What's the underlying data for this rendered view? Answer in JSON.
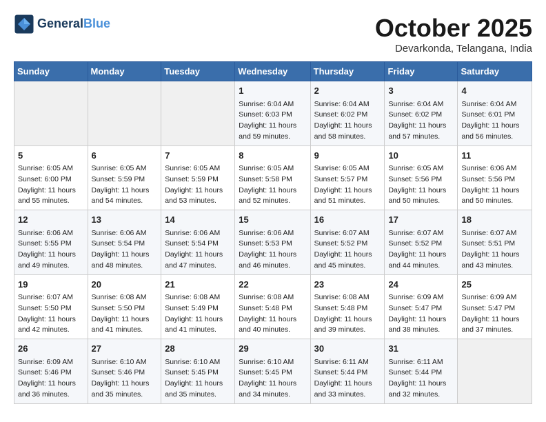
{
  "header": {
    "logo_line1": "General",
    "logo_line2": "Blue",
    "month": "October 2025",
    "location": "Devarkonda, Telangana, India"
  },
  "weekdays": [
    "Sunday",
    "Monday",
    "Tuesday",
    "Wednesday",
    "Thursday",
    "Friday",
    "Saturday"
  ],
  "weeks": [
    [
      {
        "day": "",
        "sunrise": "",
        "sunset": "",
        "daylight": ""
      },
      {
        "day": "",
        "sunrise": "",
        "sunset": "",
        "daylight": ""
      },
      {
        "day": "",
        "sunrise": "",
        "sunset": "",
        "daylight": ""
      },
      {
        "day": "1",
        "sunrise": "Sunrise: 6:04 AM",
        "sunset": "Sunset: 6:03 PM",
        "daylight": "Daylight: 11 hours and 59 minutes."
      },
      {
        "day": "2",
        "sunrise": "Sunrise: 6:04 AM",
        "sunset": "Sunset: 6:02 PM",
        "daylight": "Daylight: 11 hours and 58 minutes."
      },
      {
        "day": "3",
        "sunrise": "Sunrise: 6:04 AM",
        "sunset": "Sunset: 6:02 PM",
        "daylight": "Daylight: 11 hours and 57 minutes."
      },
      {
        "day": "4",
        "sunrise": "Sunrise: 6:04 AM",
        "sunset": "Sunset: 6:01 PM",
        "daylight": "Daylight: 11 hours and 56 minutes."
      }
    ],
    [
      {
        "day": "5",
        "sunrise": "Sunrise: 6:05 AM",
        "sunset": "Sunset: 6:00 PM",
        "daylight": "Daylight: 11 hours and 55 minutes."
      },
      {
        "day": "6",
        "sunrise": "Sunrise: 6:05 AM",
        "sunset": "Sunset: 5:59 PM",
        "daylight": "Daylight: 11 hours and 54 minutes."
      },
      {
        "day": "7",
        "sunrise": "Sunrise: 6:05 AM",
        "sunset": "Sunset: 5:59 PM",
        "daylight": "Daylight: 11 hours and 53 minutes."
      },
      {
        "day": "8",
        "sunrise": "Sunrise: 6:05 AM",
        "sunset": "Sunset: 5:58 PM",
        "daylight": "Daylight: 11 hours and 52 minutes."
      },
      {
        "day": "9",
        "sunrise": "Sunrise: 6:05 AM",
        "sunset": "Sunset: 5:57 PM",
        "daylight": "Daylight: 11 hours and 51 minutes."
      },
      {
        "day": "10",
        "sunrise": "Sunrise: 6:05 AM",
        "sunset": "Sunset: 5:56 PM",
        "daylight": "Daylight: 11 hours and 50 minutes."
      },
      {
        "day": "11",
        "sunrise": "Sunrise: 6:06 AM",
        "sunset": "Sunset: 5:56 PM",
        "daylight": "Daylight: 11 hours and 50 minutes."
      }
    ],
    [
      {
        "day": "12",
        "sunrise": "Sunrise: 6:06 AM",
        "sunset": "Sunset: 5:55 PM",
        "daylight": "Daylight: 11 hours and 49 minutes."
      },
      {
        "day": "13",
        "sunrise": "Sunrise: 6:06 AM",
        "sunset": "Sunset: 5:54 PM",
        "daylight": "Daylight: 11 hours and 48 minutes."
      },
      {
        "day": "14",
        "sunrise": "Sunrise: 6:06 AM",
        "sunset": "Sunset: 5:54 PM",
        "daylight": "Daylight: 11 hours and 47 minutes."
      },
      {
        "day": "15",
        "sunrise": "Sunrise: 6:06 AM",
        "sunset": "Sunset: 5:53 PM",
        "daylight": "Daylight: 11 hours and 46 minutes."
      },
      {
        "day": "16",
        "sunrise": "Sunrise: 6:07 AM",
        "sunset": "Sunset: 5:52 PM",
        "daylight": "Daylight: 11 hours and 45 minutes."
      },
      {
        "day": "17",
        "sunrise": "Sunrise: 6:07 AM",
        "sunset": "Sunset: 5:52 PM",
        "daylight": "Daylight: 11 hours and 44 minutes."
      },
      {
        "day": "18",
        "sunrise": "Sunrise: 6:07 AM",
        "sunset": "Sunset: 5:51 PM",
        "daylight": "Daylight: 11 hours and 43 minutes."
      }
    ],
    [
      {
        "day": "19",
        "sunrise": "Sunrise: 6:07 AM",
        "sunset": "Sunset: 5:50 PM",
        "daylight": "Daylight: 11 hours and 42 minutes."
      },
      {
        "day": "20",
        "sunrise": "Sunrise: 6:08 AM",
        "sunset": "Sunset: 5:50 PM",
        "daylight": "Daylight: 11 hours and 41 minutes."
      },
      {
        "day": "21",
        "sunrise": "Sunrise: 6:08 AM",
        "sunset": "Sunset: 5:49 PM",
        "daylight": "Daylight: 11 hours and 41 minutes."
      },
      {
        "day": "22",
        "sunrise": "Sunrise: 6:08 AM",
        "sunset": "Sunset: 5:48 PM",
        "daylight": "Daylight: 11 hours and 40 minutes."
      },
      {
        "day": "23",
        "sunrise": "Sunrise: 6:08 AM",
        "sunset": "Sunset: 5:48 PM",
        "daylight": "Daylight: 11 hours and 39 minutes."
      },
      {
        "day": "24",
        "sunrise": "Sunrise: 6:09 AM",
        "sunset": "Sunset: 5:47 PM",
        "daylight": "Daylight: 11 hours and 38 minutes."
      },
      {
        "day": "25",
        "sunrise": "Sunrise: 6:09 AM",
        "sunset": "Sunset: 5:47 PM",
        "daylight": "Daylight: 11 hours and 37 minutes."
      }
    ],
    [
      {
        "day": "26",
        "sunrise": "Sunrise: 6:09 AM",
        "sunset": "Sunset: 5:46 PM",
        "daylight": "Daylight: 11 hours and 36 minutes."
      },
      {
        "day": "27",
        "sunrise": "Sunrise: 6:10 AM",
        "sunset": "Sunset: 5:46 PM",
        "daylight": "Daylight: 11 hours and 35 minutes."
      },
      {
        "day": "28",
        "sunrise": "Sunrise: 6:10 AM",
        "sunset": "Sunset: 5:45 PM",
        "daylight": "Daylight: 11 hours and 35 minutes."
      },
      {
        "day": "29",
        "sunrise": "Sunrise: 6:10 AM",
        "sunset": "Sunset: 5:45 PM",
        "daylight": "Daylight: 11 hours and 34 minutes."
      },
      {
        "day": "30",
        "sunrise": "Sunrise: 6:11 AM",
        "sunset": "Sunset: 5:44 PM",
        "daylight": "Daylight: 11 hours and 33 minutes."
      },
      {
        "day": "31",
        "sunrise": "Sunrise: 6:11 AM",
        "sunset": "Sunset: 5:44 PM",
        "daylight": "Daylight: 11 hours and 32 minutes."
      },
      {
        "day": "",
        "sunrise": "",
        "sunset": "",
        "daylight": ""
      }
    ]
  ]
}
